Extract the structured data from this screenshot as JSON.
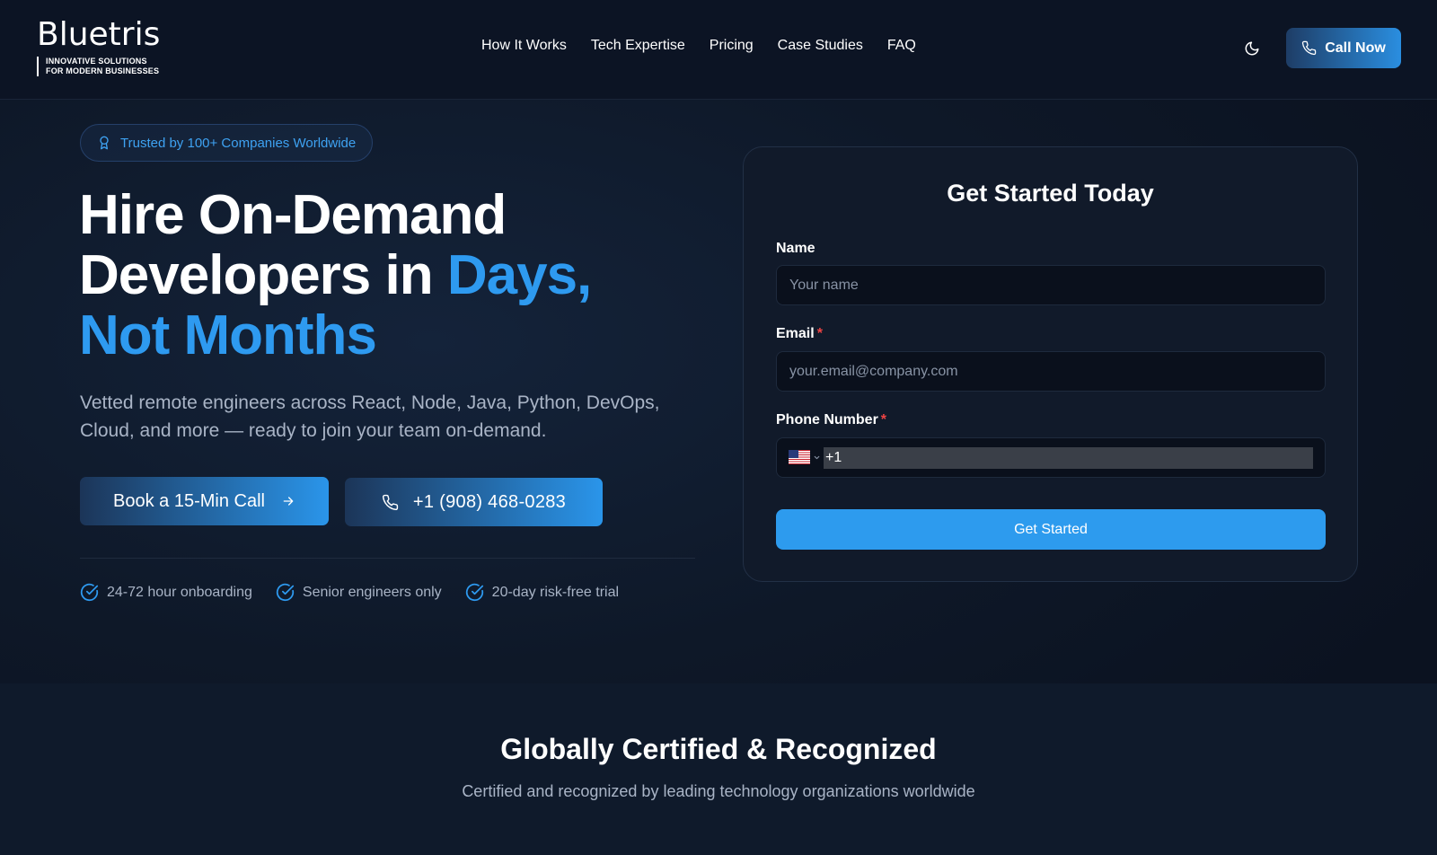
{
  "brand": {
    "name": "Bluetris",
    "tagline_line1": "INNOVATIVE SOLUTIONS",
    "tagline_line2": "FOR MODERN BUSINESSES"
  },
  "nav": {
    "items": [
      "How It Works",
      "Tech Expertise",
      "Pricing",
      "Case Studies",
      "FAQ"
    ],
    "theme_icon": "moon-icon",
    "call_now_label": "Call Now"
  },
  "hero": {
    "badge": "Trusted by 100+ Companies Worldwide",
    "headline_part1": "Hire On-Demand Developers in ",
    "headline_accent1": "Days,",
    "headline_accent2": "Not Months",
    "subtext": "Vetted remote engineers across React, Node, Java, Python, DevOps, Cloud, and more — ready to join your team on-demand.",
    "book_label": "Book a 15-Min Call",
    "phone_label": "+1 (908) 468-0283",
    "features": [
      "24-72 hour onboarding",
      "Senior engineers only",
      "20-day risk-free trial"
    ]
  },
  "form": {
    "title": "Get Started Today",
    "name_label": "Name",
    "name_placeholder": "Your name",
    "email_label": "Email",
    "email_placeholder": "your.email@company.com",
    "phone_label": "Phone Number",
    "required_mark": "*",
    "phone_value": "+1",
    "submit_label": "Get Started"
  },
  "certified": {
    "title": "Globally Certified & Recognized",
    "subtitle": "Certified and recognized by leading technology organizations worldwide"
  },
  "colors": {
    "accent": "#2e9af0",
    "background": "#0b1220",
    "required": "#ef4444"
  }
}
